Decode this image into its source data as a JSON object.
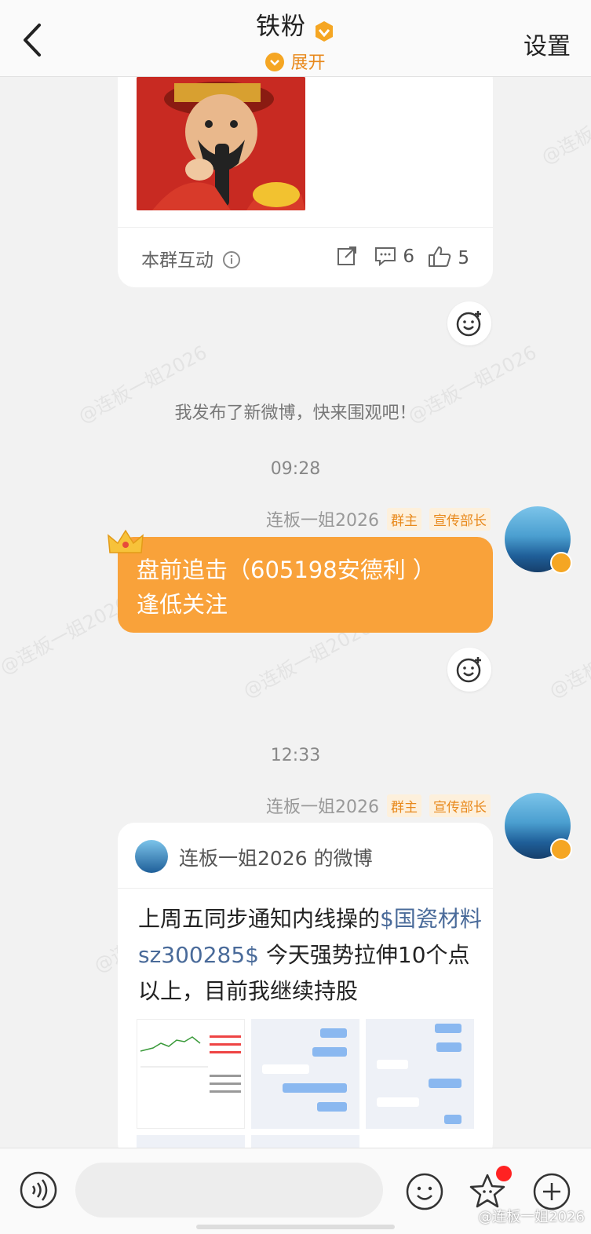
{
  "header": {
    "title": "铁粉",
    "expand_label": "展开",
    "settings_label": "设置"
  },
  "post_card": {
    "interact_label": "本群互动",
    "comments": "6",
    "likes": "5"
  },
  "system_message": "我发布了新微博，快来围观吧！",
  "times": [
    "09:28",
    "12:33"
  ],
  "messages": [
    {
      "sender": "连板一姐2026",
      "tags": [
        "群主",
        "宣传部长"
      ],
      "text_line1": "盘前追击（605198安德利 ）",
      "text_line2": "逢低关注"
    },
    {
      "sender": "连板一姐2026",
      "tags": [
        "群主",
        "宣传部长"
      ],
      "card_title": "连板一姐2026 的微博",
      "body_prefix": "上周五同步通知内线操的",
      "body_link": "$国瓷材料 sz300285$",
      "body_suffix": " 今天强势拉伸10个点以上，目前我继续持股"
    }
  ],
  "watermark": "@连板一姐2026",
  "colors": {
    "accent": "#f9a23a",
    "tag_text": "#e8891c",
    "link": "#4a6b9a"
  }
}
